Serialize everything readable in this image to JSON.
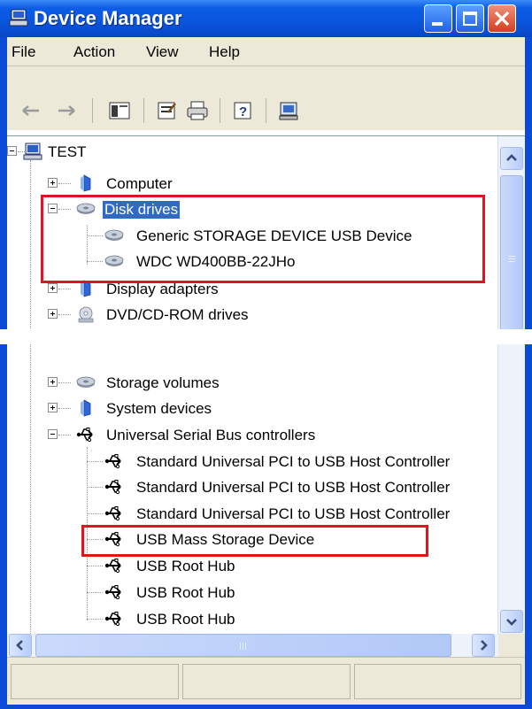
{
  "window": {
    "title": "Device Manager",
    "colors": {
      "titlebar": "#0a55dc",
      "selection": "#316ac5",
      "highlight_box": "#e0141e",
      "chrome": "#ece9d8"
    }
  },
  "menu": [
    "File",
    "Action",
    "View",
    "Help"
  ],
  "toolbar": [
    "back-arrow-icon",
    "forward-arrow-icon",
    "show-hide-console-tree-icon",
    "properties-icon",
    "print-icon",
    "help-icon",
    "scan-hardware-icon"
  ],
  "tree_top": {
    "root": "TEST",
    "computer": "Computer",
    "disk_drives": "Disk drives",
    "disk_children": [
      "Generic STORAGE DEVICE USB Device",
      "WDC WD400BB-22JHo"
    ],
    "display_adapters": "Display adapters",
    "dvd": "DVD/CD-ROM drives"
  },
  "tree_bottom": {
    "storage_volumes": "Storage volumes",
    "system_devices": "System devices",
    "usb_controllers": "Universal Serial Bus controllers",
    "usb_children": [
      "Standard Universal PCI to USB Host Controller",
      "Standard Universal PCI to USB Host Controller",
      "Standard Universal PCI to USB Host Controller",
      "USB Mass Storage Device",
      "USB Root Hub",
      "USB Root Hub",
      "USB Root Hub"
    ]
  },
  "icons": {
    "disk": "disk-drive-icon",
    "usb": "usb-icon",
    "computer": "computer-icon",
    "monitor": "monitor-icon",
    "dvd": "dvd-drive-icon",
    "storage": "storage-volume-icon",
    "system": "system-devices-icon"
  }
}
